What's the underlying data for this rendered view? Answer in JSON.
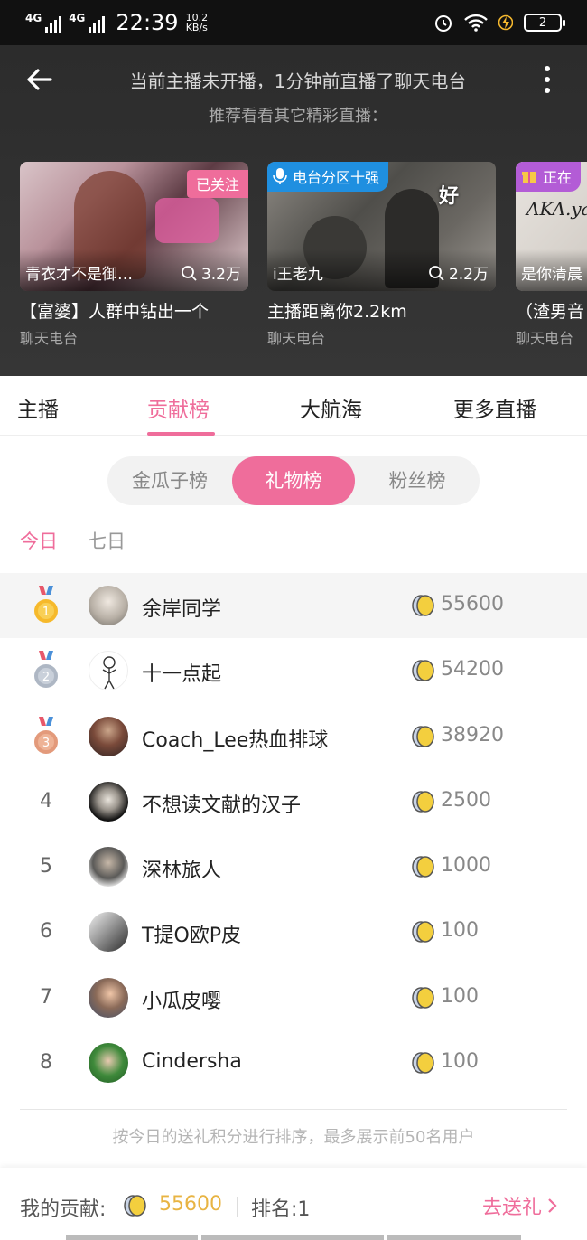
{
  "status_bar": {
    "net1": "4G",
    "net2": "4G",
    "time": "22:39",
    "speed_value": "10.2",
    "speed_unit": "KB/s",
    "battery": "2"
  },
  "header": {
    "notice": "当前主播未开播，1分钟前直播了聊天电台",
    "subnotice": "推荐看看其它精彩直播："
  },
  "recommended": [
    {
      "nick": "青衣才不是御…",
      "viewers": "3.2万",
      "tag": "已关注",
      "title": "【富婆】人群中钻出一个",
      "category": "聊天电台"
    },
    {
      "nick": "i王老九",
      "viewers": "2.2万",
      "tag": "电台分区十强",
      "title": "主播距离你2.2km",
      "category": "聊天电台"
    },
    {
      "nick": "是你清晨",
      "viewers": "",
      "tag": "正在",
      "title": "（渣男音",
      "category": "聊天电台"
    }
  ],
  "tabs": [
    "主播",
    "贡献榜",
    "大航海",
    "更多直播"
  ],
  "active_tab": "贡献榜",
  "segments": [
    "金瓜子榜",
    "礼物榜",
    "粉丝榜"
  ],
  "active_segment": "礼物榜",
  "periods": [
    "今日",
    "七日"
  ],
  "active_period": "今日",
  "ranking": [
    {
      "rank": "1",
      "name": "余岸同学",
      "score": "55600"
    },
    {
      "rank": "2",
      "name": "十一点起",
      "score": "54200"
    },
    {
      "rank": "3",
      "name": "Coach_Lee热血排球",
      "score": "38920"
    },
    {
      "rank": "4",
      "name": "不想读文献的汉子",
      "score": "2500"
    },
    {
      "rank": "5",
      "name": "深林旅人",
      "score": "1000"
    },
    {
      "rank": "6",
      "name": "T提O欧P皮",
      "score": "100"
    },
    {
      "rank": "7",
      "name": "小瓜皮嘤",
      "score": "100"
    },
    {
      "rank": "8",
      "name": "Cindersha",
      "score": "100"
    }
  ],
  "footnote": "按今日的送礼积分进行排序，最多展示前50名用户",
  "my_contribution": {
    "label": "我的贡献:",
    "score": "55600",
    "rank": "排名:1",
    "action": "去送礼"
  },
  "colors": {
    "accent": "#ef6d9b",
    "gold": "#e8b443",
    "header_bg": "#323232"
  }
}
